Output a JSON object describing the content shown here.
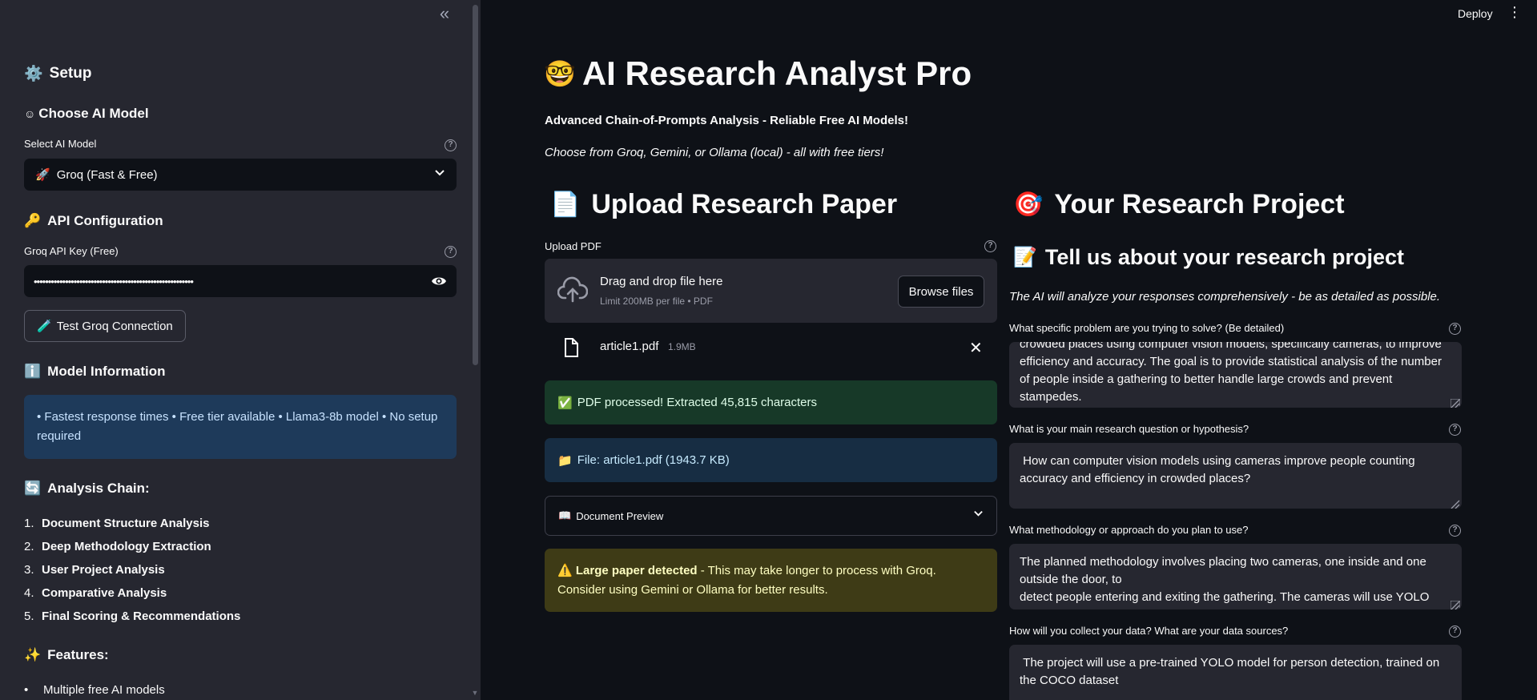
{
  "sidebar": {
    "setup_icon": "⚙️",
    "setup_title": "Setup",
    "choose_model_title": "Choose AI Model",
    "choose_model_icon": "☺",
    "select_label": "Select AI Model",
    "selected_model": "Groq (Fast & Free)",
    "selected_model_icon": "🚀",
    "api_title": "API Configuration",
    "api_icon": "🔑",
    "api_key_label": "Groq API Key (Free)",
    "api_key_value": "••••••••••••••••••••••••••••••••••••••••••••••••••••••••",
    "test_button": "Test Groq Connection",
    "test_icon": "🧪",
    "model_info_title": "Model Information",
    "model_info_icon": "ℹ️",
    "model_info_text": "• Fastest response times • Free tier available • Llama3-8b model • No setup required",
    "analysis_chain_title": "Analysis Chain:",
    "analysis_chain_icon": "🔄",
    "analysis_chain": [
      {
        "num": "1.",
        "label": "Document Structure Analysis"
      },
      {
        "num": "2.",
        "label": "Deep Methodology Extraction"
      },
      {
        "num": "3.",
        "label": "User Project Analysis"
      },
      {
        "num": "4.",
        "label": "Comparative Analysis"
      },
      {
        "num": "5.",
        "label": "Final Scoring & Recommendations"
      }
    ],
    "features_title": "Features:",
    "features_icon": "✨",
    "features": [
      "Multiple free AI models"
    ]
  },
  "header": {
    "deploy": "Deploy"
  },
  "main": {
    "title": "AI Research Analyst Pro",
    "title_icon": "🤓",
    "subtitle": "Advanced Chain-of-Prompts Analysis - Reliable Free AI Models!",
    "subtitle2": "Choose from Groq, Gemini, or Ollama (local) - all with free tiers!",
    "upload": {
      "title": "Upload Research Paper",
      "icon": "📄",
      "label": "Upload PDF",
      "drag_text": "Drag and drop file here",
      "limit_text": "Limit 200MB per file • PDF",
      "browse": "Browse files",
      "file_name": "article1.pdf",
      "file_size": "1.9MB",
      "success": "PDF processed! Extracted 45,815 characters",
      "success_icon": "✅",
      "file_info": "File: article1.pdf (1943.7 KB)",
      "file_info_icon": "📁",
      "preview": "Document Preview",
      "preview_icon": "📖",
      "warning_bold": "Large paper detected",
      "warning_text": " - This may take longer to process with Groq. Consider using Gemini or Ollama for better results.",
      "warning_icon": "⚠️"
    },
    "project": {
      "title": "Your Research Project",
      "icon": "🎯",
      "subtitle": "Tell us about your research project",
      "subtitle_icon": "📝",
      "caption": "The AI will analyze your responses comprehensively - be as detailed as possible.",
      "q1_label": "What specific problem are you trying to solve? (Be detailed)",
      "q1_value": "crowded places using computer vision models, specifically cameras, to improve efficiency and accuracy. The goal is to provide statistical analysis of the number of people inside a gathering to better handle large crowds and prevent stampedes.",
      "q2_label": "What is your main research question or hypothesis?",
      "q2_value": " How can computer vision models using cameras improve people counting accuracy and efficiency in crowded places?",
      "q3_label": "What methodology or approach do you plan to use?",
      "q3_value": "The planned methodology involves placing two cameras, one inside and one outside the door, to\ndetect people entering and exiting the gathering. The cameras will use YOLO",
      "q4_label": "How will you collect your data? What are your data sources?",
      "q4_value": " The project will use a pre-trained YOLO model for person detection, trained on the COCO dataset"
    }
  },
  "colors": {
    "sidebar_bg": "#262730",
    "main_bg": "#0e1117",
    "success_bg": "#173928",
    "info_bg": "#172d43",
    "warning_bg": "#3e3b16",
    "model_info_bg": "#1e3a5a"
  },
  "icons": {
    "collapse": "double-chevron-left-icon",
    "help": "question-circle-icon",
    "eye": "eye-icon",
    "cloud": "cloud-upload-icon",
    "file": "file-icon",
    "close": "close-icon",
    "chevron": "chevron-down-icon",
    "kebab": "kebab-menu-icon"
  }
}
